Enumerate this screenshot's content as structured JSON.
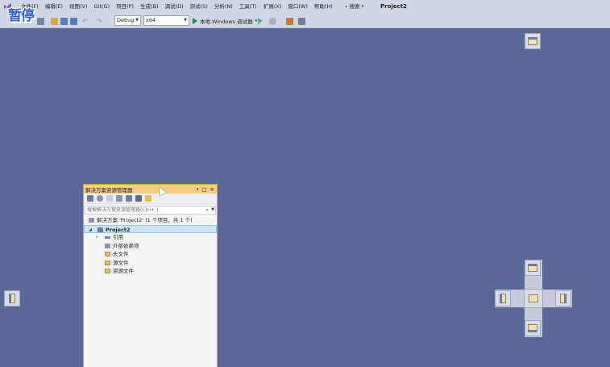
{
  "menubar": {
    "items": [
      "文件(F)",
      "编辑(E)",
      "视图(V)",
      "Git(G)",
      "项目(P)",
      "生成(B)",
      "调试(D)",
      "测试(S)",
      "分析(N)",
      "工具(T)",
      "扩展(X)",
      "窗口(W)",
      "帮助(H)"
    ],
    "search_label": "搜索",
    "project_title": "Project2"
  },
  "overlay": {
    "pause_text": "暂停"
  },
  "toolbar": {
    "config": "Debug",
    "platform": "x64",
    "run_label": "本地 Windows 调试器"
  },
  "solution_explorer": {
    "title": "解决方案资源管理器",
    "search_placeholder": "搜索解决方案资源管理器(Ctrl+;)",
    "solution_label": "解决方案 'Project2' (1 个项目，共 1 个)",
    "project_label": "Project2",
    "nodes": [
      "引用",
      "外部依赖项",
      "头文件",
      "源文件",
      "资源文件"
    ]
  },
  "colors": {
    "background": "#5a6898",
    "menubar": "#cfd6e5",
    "panel_title": "#f5cc84",
    "selection": "#cce3f8",
    "pause_text": "#2d5fd0"
  },
  "icons": [
    "vs-logo-icon",
    "search-icon",
    "play-icon",
    "pin-icon",
    "maximize-icon",
    "close-icon",
    "folder-icon",
    "reference-icon",
    "solution-icon",
    "project-icon"
  ]
}
